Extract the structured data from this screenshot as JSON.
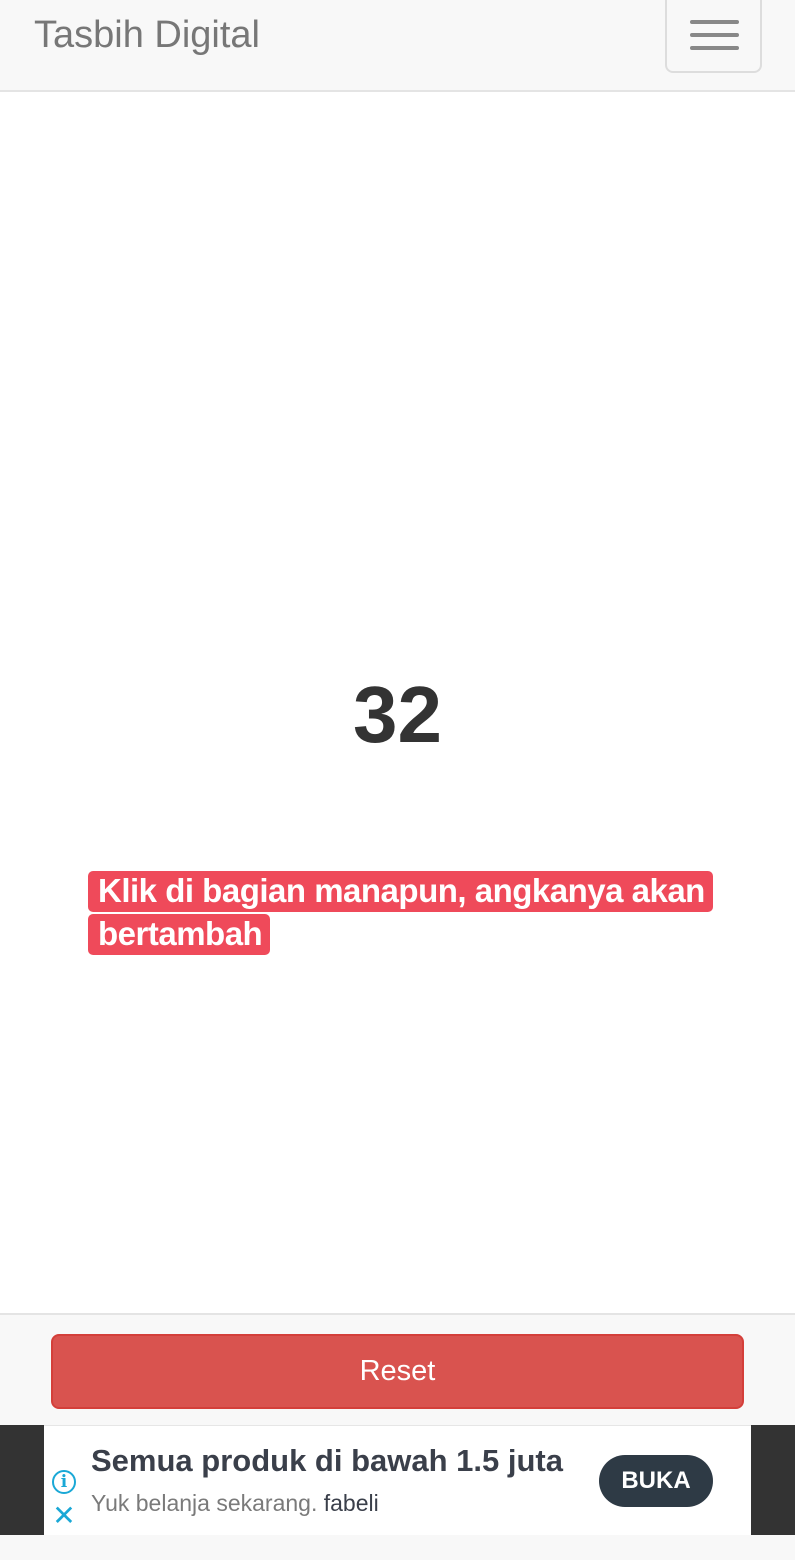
{
  "navbar": {
    "brand": "Tasbih Digital",
    "menu_icon": "hamburger-menu-icon"
  },
  "counter": {
    "value": "32",
    "hint": "Klik di bagian manapun, angkanya akan bertambah"
  },
  "footer": {
    "reset_label": "Reset"
  },
  "ad": {
    "title": "Semua produk di bawah 1.5 juta",
    "subtitle": "Yuk belanja sekarang.",
    "advertiser": "fabeli",
    "cta_label": "BUKA",
    "info_icon": "info-icon",
    "close_icon": "close-icon",
    "info_glyph": "i",
    "close_glyph": "✕"
  },
  "colors": {
    "hint_bg": "#ef4a5a",
    "reset_bg": "#d9534f",
    "cta_bg": "#2e3a45",
    "ad_icon": "#1aa8d6"
  }
}
